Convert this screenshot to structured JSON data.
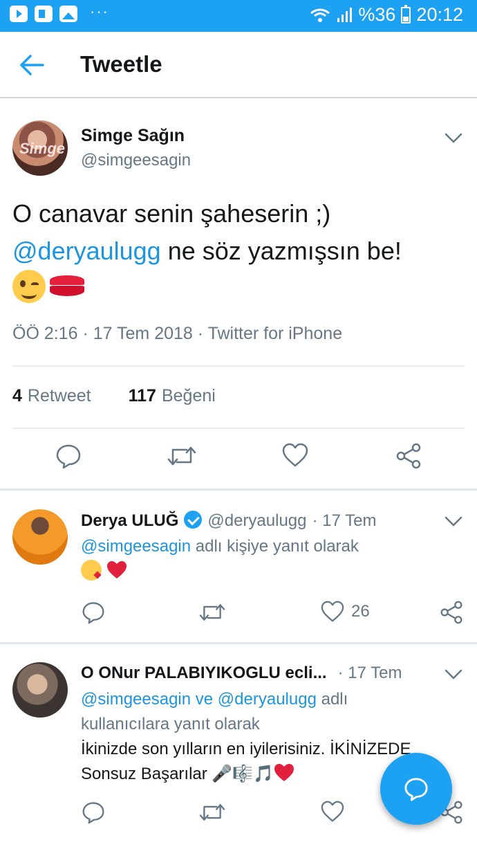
{
  "status_bar": {
    "battery": "%36",
    "time": "20:12",
    "overflow": "···"
  },
  "header": {
    "title": "Tweetle"
  },
  "tweet": {
    "author_name": "Simge Sağın",
    "author_handle": "@simgeesagin",
    "avatar_text": "Simge",
    "text_line1": "O canavar senin şaheserin ;)",
    "mention": "@deryaulugg",
    "text_line2_rest": " ne söz yazmışsın be!",
    "meta": "ÖÖ 2:16 · 17 Tem 2018 · Twitter for iPhone",
    "retweet_count": "4",
    "retweet_label": "Retweet",
    "like_count": "117",
    "like_label": "Beğeni"
  },
  "replies": [
    {
      "name": "Derya ULUĞ",
      "verified": true,
      "handle": "@deryaulugg",
      "date": "· 17 Tem",
      "reply_to_mention": "@simgeesagin",
      "reply_to_text": " adlı kişiye yanıt olarak",
      "like_count": "26"
    },
    {
      "name": "O ONur PALABIYIKOGLU ecli...",
      "date": "· 17 Tem",
      "reply_to_mention1": "@simgeesagin",
      "reply_to_and": " ve ",
      "reply_to_mention2": "@deryaulugg",
      "reply_to_text": " adlı",
      "reply_to_text2": "kullanıcılara yanıt olarak",
      "text_line1": "İkinizde son yılların en iyilerisiniz. İKİNİZEDE",
      "text_line2": "Sonsuz Başarılar 🎤🎼🎵"
    }
  ],
  "colors": {
    "accent": "#1da1f2",
    "link": "#1b95e0",
    "secondary_text": "#657786",
    "divider": "#e6ecf0"
  }
}
